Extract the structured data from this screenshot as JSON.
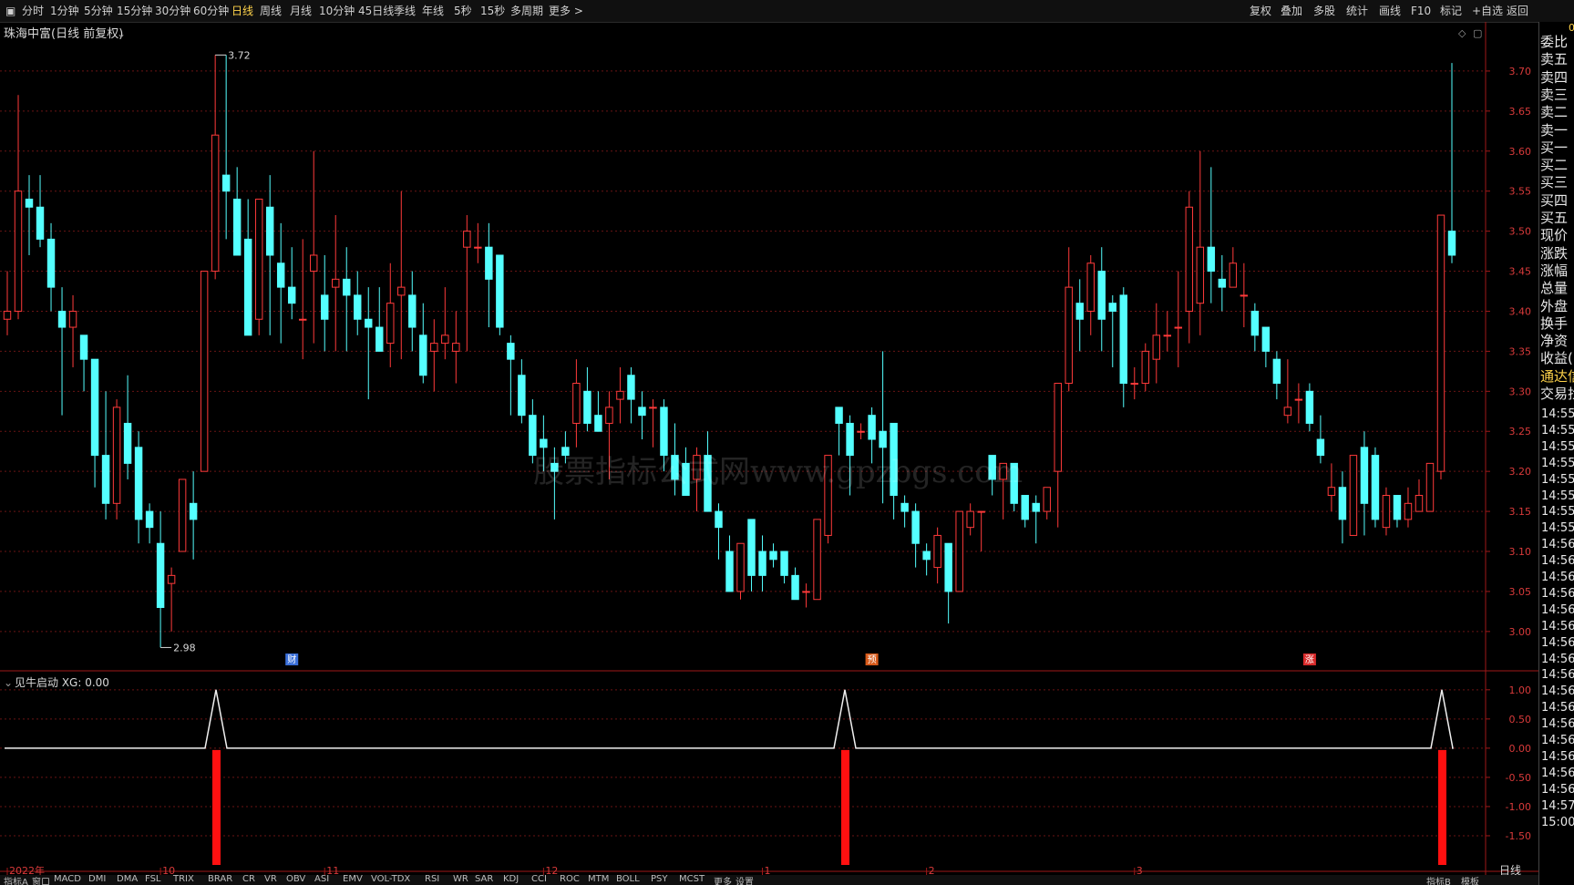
{
  "toolbar": {
    "periods": [
      "分时",
      "1分钟",
      "5分钟",
      "15分钟",
      "30分钟",
      "60分钟",
      "日线",
      "周线",
      "月线",
      "10分钟",
      "45日线",
      "季线",
      "年线",
      "5秒",
      "15秒",
      "多周期",
      "更多 >"
    ],
    "active_period": "日线",
    "right_buttons": [
      "复权",
      "叠加",
      "多股",
      "统计",
      "画线",
      "F10",
      "标记",
      "+自选",
      "返回"
    ]
  },
  "main": {
    "title": "珠海中富(日线 前复权)",
    "watermark": "股票指标公式网www.gpzbgs.com",
    "markers": [
      {
        "label": "财",
        "color": "#3a6fd8",
        "index": 26
      },
      {
        "label": "预",
        "color": "#d85a1a",
        "index": 79
      },
      {
        "label": "涨",
        "color": "#d82a2a",
        "index": 119
      }
    ]
  },
  "indicator": {
    "title": "见牛启动 XG: 0.00"
  },
  "right_panel": {
    "top_value": "0",
    "items": [
      "委比",
      "卖五",
      "卖四",
      "卖三",
      "卖二",
      "卖一",
      "买一",
      "买二",
      "买三",
      "买四",
      "买五",
      "现价",
      "涨跌",
      "涨幅",
      "总量",
      "外盘",
      "换手",
      "净资",
      "收益(",
      "通达信",
      "交易找"
    ],
    "times": [
      "14:55",
      "14:55",
      "14:55",
      "14:55",
      "14:55",
      "14:55",
      "14:55",
      "14:55",
      "14:56",
      "14:56",
      "14:56",
      "14:56",
      "14:56",
      "14:56",
      "14:56",
      "14:56",
      "14:56",
      "14:56",
      "14:56",
      "14:56",
      "14:56",
      "14:56",
      "14:56",
      "14:56",
      "14:57",
      "15:00"
    ]
  },
  "bottom_bar": [
    "指标A",
    "窗口",
    "MACD",
    "DMI",
    "DMA",
    "FSL",
    "TRIX",
    "BRAR",
    "CR",
    "VR",
    "OBV",
    "ASI",
    "EMV",
    "VOL-TDX",
    "RSI",
    "WR",
    "SAR",
    "KDJ",
    "CCI",
    "ROC",
    "MTM",
    "BOLL",
    "PSY",
    "MCST",
    "更多",
    "设置"
  ],
  "bottom_right": [
    "指标B",
    "模板"
  ],
  "period_tag": "日线",
  "chart_data": [
    {
      "type": "candlestick",
      "title": "珠海中富(日线 前复权)",
      "ylim": [
        2.96,
        3.75
      ],
      "y_ticks": [
        3.0,
        3.05,
        3.1,
        3.15,
        3.2,
        3.25,
        3.3,
        3.35,
        3.4,
        3.45,
        3.5,
        3.55,
        3.6,
        3.65,
        3.7
      ],
      "annotations": [
        {
          "text": "3.72",
          "index": 19,
          "value": 3.72
        },
        {
          "text": "2.98",
          "index": 14,
          "value": 2.98
        }
      ],
      "x_labels": [
        {
          "text": "2022年",
          "index": 0
        },
        {
          "text": "10",
          "index": 14
        },
        {
          "text": "11",
          "index": 29
        },
        {
          "text": "12",
          "index": 49
        },
        {
          "text": "1",
          "index": 69
        },
        {
          "text": "2",
          "index": 84
        },
        {
          "text": "3",
          "index": 103
        }
      ],
      "ohlc": [
        [
          3.39,
          3.45,
          3.37,
          3.4
        ],
        [
          3.4,
          3.67,
          3.39,
          3.55
        ],
        [
          3.54,
          3.57,
          3.47,
          3.53
        ],
        [
          3.53,
          3.57,
          3.48,
          3.49
        ],
        [
          3.49,
          3.51,
          3.4,
          3.43
        ],
        [
          3.4,
          3.43,
          3.27,
          3.38
        ],
        [
          3.38,
          3.42,
          3.33,
          3.4
        ],
        [
          3.37,
          3.37,
          3.3,
          3.34
        ],
        [
          3.34,
          3.34,
          3.18,
          3.22
        ],
        [
          3.22,
          3.3,
          3.14,
          3.16
        ],
        [
          3.16,
          3.29,
          3.14,
          3.28
        ],
        [
          3.26,
          3.32,
          3.19,
          3.21
        ],
        [
          3.23,
          3.25,
          3.11,
          3.14
        ],
        [
          3.15,
          3.16,
          3.11,
          3.13
        ],
        [
          3.11,
          3.15,
          2.98,
          3.03
        ],
        [
          3.06,
          3.08,
          3.0,
          3.07
        ],
        [
          3.1,
          3.18,
          3.1,
          3.19
        ],
        [
          3.16,
          3.2,
          3.09,
          3.14
        ],
        [
          3.2,
          3.45,
          3.2,
          3.45
        ],
        [
          3.45,
          3.72,
          3.44,
          3.62
        ],
        [
          3.57,
          3.72,
          3.49,
          3.55
        ],
        [
          3.54,
          3.58,
          3.48,
          3.47
        ],
        [
          3.49,
          3.54,
          3.37,
          3.37
        ],
        [
          3.39,
          3.53,
          3.37,
          3.54
        ],
        [
          3.53,
          3.57,
          3.37,
          3.47
        ],
        [
          3.46,
          3.51,
          3.36,
          3.43
        ],
        [
          3.43,
          3.48,
          3.39,
          3.41
        ],
        [
          3.39,
          3.49,
          3.34,
          3.39
        ],
        [
          3.45,
          3.6,
          3.36,
          3.47
        ],
        [
          3.42,
          3.47,
          3.35,
          3.39
        ],
        [
          3.43,
          3.52,
          3.35,
          3.44
        ],
        [
          3.44,
          3.48,
          3.35,
          3.42
        ],
        [
          3.42,
          3.45,
          3.37,
          3.39
        ],
        [
          3.39,
          3.43,
          3.29,
          3.38
        ],
        [
          3.38,
          3.43,
          3.35,
          3.35
        ],
        [
          3.36,
          3.46,
          3.33,
          3.41
        ],
        [
          3.42,
          3.55,
          3.34,
          3.43
        ],
        [
          3.42,
          3.45,
          3.35,
          3.38
        ],
        [
          3.37,
          3.41,
          3.31,
          3.32
        ],
        [
          3.35,
          3.39,
          3.3,
          3.36
        ],
        [
          3.36,
          3.43,
          3.34,
          3.37
        ],
        [
          3.35,
          3.4,
          3.31,
          3.36
        ],
        [
          3.48,
          3.52,
          3.35,
          3.5
        ],
        [
          3.48,
          3.51,
          3.46,
          3.48
        ],
        [
          3.48,
          3.51,
          3.38,
          3.44
        ],
        [
          3.47,
          3.47,
          3.37,
          3.38
        ],
        [
          3.36,
          3.37,
          3.27,
          3.34
        ],
        [
          3.32,
          3.34,
          3.26,
          3.27
        ],
        [
          3.27,
          3.29,
          3.21,
          3.22
        ],
        [
          3.24,
          3.27,
          3.2,
          3.23
        ],
        [
          3.21,
          3.23,
          3.14,
          3.2
        ],
        [
          3.23,
          3.25,
          3.21,
          3.22
        ],
        [
          3.26,
          3.34,
          3.23,
          3.31
        ],
        [
          3.3,
          3.33,
          3.25,
          3.26
        ],
        [
          3.27,
          3.3,
          3.25,
          3.25
        ],
        [
          3.26,
          3.3,
          3.19,
          3.28
        ],
        [
          3.29,
          3.33,
          3.26,
          3.3
        ],
        [
          3.32,
          3.33,
          3.26,
          3.29
        ],
        [
          3.28,
          3.3,
          3.24,
          3.27
        ],
        [
          3.28,
          3.29,
          3.23,
          3.28
        ],
        [
          3.28,
          3.29,
          3.2,
          3.22
        ],
        [
          3.22,
          3.26,
          3.17,
          3.19
        ],
        [
          3.21,
          3.23,
          3.17,
          3.17
        ],
        [
          3.19,
          3.23,
          3.15,
          3.22
        ],
        [
          3.22,
          3.25,
          3.16,
          3.15
        ],
        [
          3.15,
          3.16,
          3.09,
          3.13
        ],
        [
          3.1,
          3.12,
          3.06,
          3.05
        ],
        [
          3.05,
          3.09,
          3.04,
          3.11
        ],
        [
          3.14,
          3.14,
          3.05,
          3.07
        ],
        [
          3.1,
          3.12,
          3.05,
          3.07
        ],
        [
          3.1,
          3.11,
          3.08,
          3.09
        ],
        [
          3.1,
          3.1,
          3.06,
          3.07
        ],
        [
          3.07,
          3.08,
          3.04,
          3.04
        ],
        [
          3.05,
          3.06,
          3.03,
          3.05
        ],
        [
          3.04,
          3.1,
          3.04,
          3.14
        ],
        [
          3.12,
          3.18,
          3.11,
          3.22
        ],
        [
          3.28,
          3.27,
          3.22,
          3.26
        ],
        [
          3.26,
          3.27,
          3.17,
          3.22
        ],
        [
          3.25,
          3.26,
          3.24,
          3.25
        ],
        [
          3.27,
          3.28,
          3.21,
          3.24
        ],
        [
          3.25,
          3.35,
          3.16,
          3.23
        ],
        [
          3.26,
          3.26,
          3.14,
          3.17
        ],
        [
          3.16,
          3.17,
          3.13,
          3.15
        ],
        [
          3.15,
          3.16,
          3.08,
          3.11
        ],
        [
          3.1,
          3.11,
          3.07,
          3.09
        ],
        [
          3.08,
          3.13,
          3.06,
          3.12
        ],
        [
          3.11,
          3.11,
          3.01,
          3.05
        ],
        [
          3.05,
          3.14,
          3.05,
          3.15
        ],
        [
          3.13,
          3.16,
          3.12,
          3.15
        ],
        [
          3.15,
          3.15,
          3.1,
          3.15
        ],
        [
          3.22,
          3.22,
          3.17,
          3.19
        ],
        [
          3.19,
          3.21,
          3.14,
          3.21
        ],
        [
          3.21,
          3.21,
          3.15,
          3.16
        ],
        [
          3.17,
          3.17,
          3.13,
          3.14
        ],
        [
          3.16,
          3.17,
          3.11,
          3.15
        ],
        [
          3.15,
          3.18,
          3.14,
          3.18
        ],
        [
          3.2,
          3.31,
          3.13,
          3.31
        ],
        [
          3.31,
          3.48,
          3.3,
          3.43
        ],
        [
          3.41,
          3.44,
          3.35,
          3.39
        ],
        [
          3.4,
          3.47,
          3.37,
          3.46
        ],
        [
          3.45,
          3.48,
          3.35,
          3.39
        ],
        [
          3.41,
          3.42,
          3.33,
          3.4
        ],
        [
          3.42,
          3.43,
          3.28,
          3.31
        ],
        [
          3.31,
          3.33,
          3.29,
          3.31
        ],
        [
          3.31,
          3.36,
          3.3,
          3.35
        ],
        [
          3.34,
          3.41,
          3.31,
          3.37
        ],
        [
          3.37,
          3.4,
          3.35,
          3.37
        ],
        [
          3.38,
          3.45,
          3.33,
          3.38
        ],
        [
          3.4,
          3.55,
          3.36,
          3.53
        ],
        [
          3.41,
          3.6,
          3.37,
          3.48
        ],
        [
          3.48,
          3.58,
          3.41,
          3.45
        ],
        [
          3.44,
          3.47,
          3.4,
          3.43
        ],
        [
          3.43,
          3.48,
          3.43,
          3.46
        ],
        [
          3.42,
          3.46,
          3.38,
          3.42
        ],
        [
          3.4,
          3.41,
          3.35,
          3.37
        ],
        [
          3.38,
          3.38,
          3.33,
          3.35
        ],
        [
          3.34,
          3.35,
          3.29,
          3.31
        ],
        [
          3.27,
          3.34,
          3.26,
          3.28
        ],
        [
          3.29,
          3.31,
          3.26,
          3.29
        ],
        [
          3.3,
          3.31,
          3.25,
          3.26
        ],
        [
          3.24,
          3.27,
          3.21,
          3.22
        ],
        [
          3.17,
          3.21,
          3.15,
          3.18
        ],
        [
          3.18,
          3.2,
          3.11,
          3.14
        ],
        [
          3.12,
          3.19,
          3.13,
          3.22
        ],
        [
          3.23,
          3.25,
          3.12,
          3.16
        ],
        [
          3.22,
          3.23,
          3.13,
          3.14
        ],
        [
          3.13,
          3.18,
          3.12,
          3.17
        ],
        [
          3.17,
          3.17,
          3.13,
          3.14
        ],
        [
          3.14,
          3.18,
          3.13,
          3.16
        ],
        [
          3.15,
          3.19,
          3.15,
          3.17
        ],
        [
          3.15,
          3.21,
          3.15,
          3.21
        ],
        [
          3.2,
          3.52,
          3.19,
          3.52
        ],
        [
          3.5,
          3.71,
          3.46,
          3.47
        ]
      ]
    },
    {
      "type": "line",
      "title": "见牛启动 XG: 0.00",
      "ylim": [
        -2.0,
        1.2
      ],
      "y_ticks": [
        1.0,
        0.5,
        0.0,
        -0.5,
        -1.0,
        -1.5
      ],
      "line_value": 0,
      "signals": [
        19,
        82,
        141
      ],
      "signal_peak": 1.0,
      "signal_bar_value": -2.0
    }
  ]
}
